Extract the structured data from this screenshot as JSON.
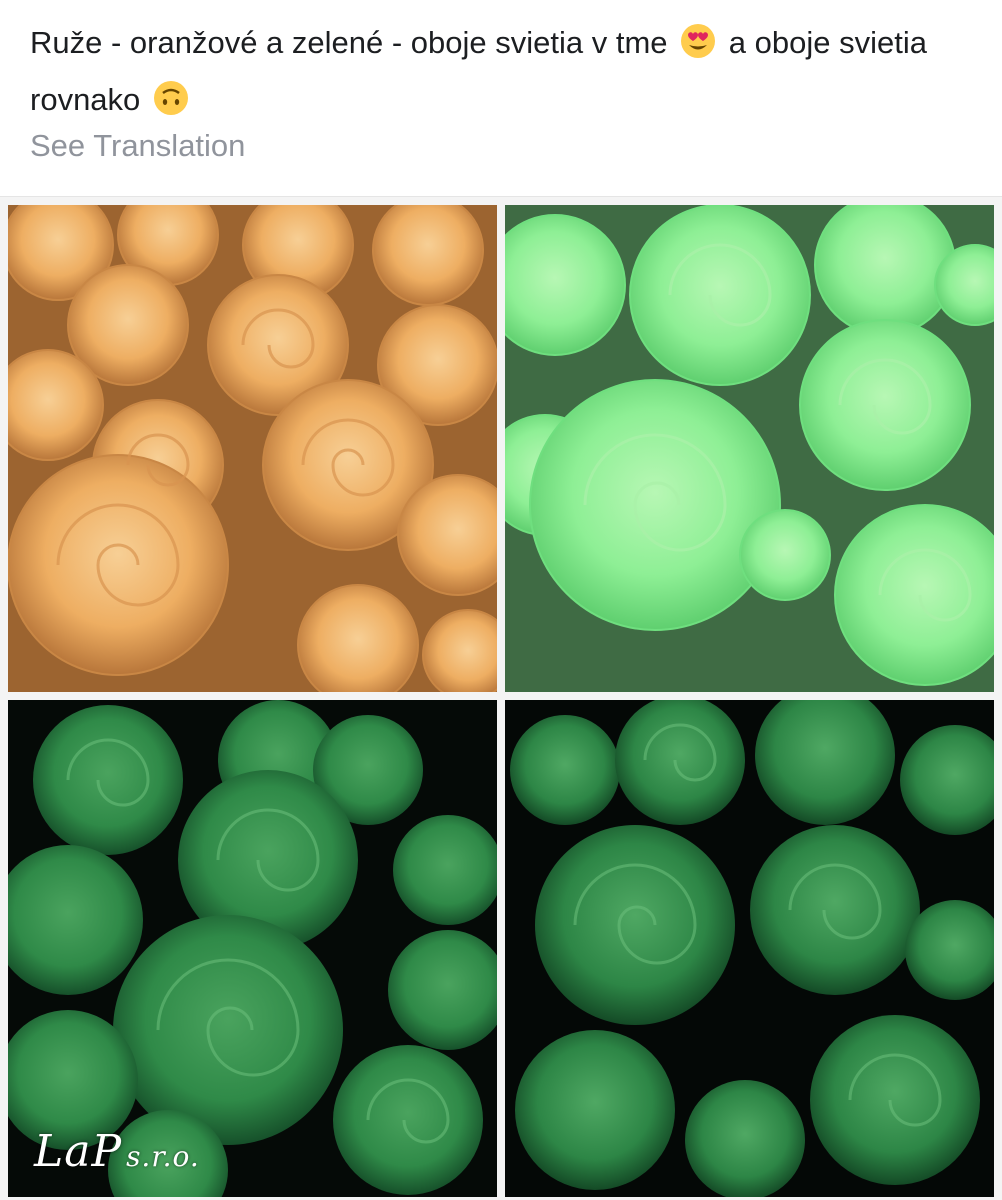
{
  "post": {
    "text_part1": "Ruže - oranžové a zelené - oboje svietia v tme",
    "text_part2": "a oboje svietia rovnako",
    "emoji_1": "smiling-face-with-heart-eyes-icon",
    "emoji_2": "upside-down-face-icon",
    "see_translation": "See Translation"
  },
  "photos": [
    {
      "position": "top-left",
      "description": "orange roses in daylight"
    },
    {
      "position": "top-right",
      "description": "light green roses in daylight"
    },
    {
      "position": "bottom-left",
      "description": "green roses glowing in the dark"
    },
    {
      "position": "bottom-right",
      "description": "green roses glowing in the dark"
    }
  ],
  "watermark": {
    "logo": "LaP",
    "suffix": "s.r.o."
  },
  "colors": {
    "text": "#1c1e21",
    "secondary": "#90949c",
    "orange_rose": "#f2b56b",
    "light_green_rose": "#8ff29a",
    "dark_green_rose": "#2f8a4a"
  }
}
